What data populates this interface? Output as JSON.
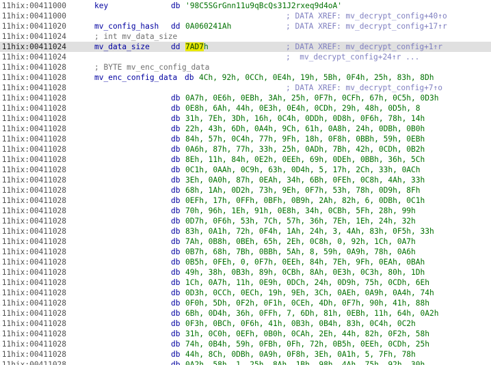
{
  "highlight_color": "#e8e800",
  "selected_line_color": "#e0e0e0",
  "lines": [
    {
      "addr": ".11hix:00411000",
      "label": "key",
      "dir": "db",
      "ops": "'98C5SGrGnn11u9qBcQs31J2rxeq9d4oA'"
    },
    {
      "addr": ".11hix:00411000",
      "xref": "; DATA XREF: mv_decrypt_config+40↑o"
    },
    {
      "addr": ".11hix:00411020",
      "label": "mv_config_hash",
      "dir": "dd",
      "ops": "0A060241Ah",
      "xref": "; DATA XREF: mv_decrypt_config+17↑r"
    },
    {
      "addr": ".11hix:00411024",
      "comment": "; int mv_data_size"
    },
    {
      "addr": ".11hix:00411024",
      "label": "mv_data_size",
      "dir": "dd",
      "ops_hl": "7AD7",
      "ops_tail": "h",
      "xref": "; DATA XREF: mv_decrypt_config+1↑r",
      "selected": true
    },
    {
      "addr": ".11hix:00411024",
      "xref": ";  mv_decrypt_config+24↑r ..."
    },
    {
      "addr": ".11hix:00411028",
      "comment": "; BYTE mv_enc_config_data"
    },
    {
      "addr": ".11hix:00411028",
      "label": "mv_enc_config_data",
      "dir": "db",
      "ops": "4Ch, 92h, 0CCh, 0E4h, 19h, 5Bh, 0F4h, 25h, 83h, 8Dh"
    },
    {
      "addr": ".11hix:00411028",
      "xref": "; DATA XREF: mv_decrypt_config+7↑o"
    },
    {
      "addr": ".11hix:00411028",
      "dir": "db",
      "ops": "0A7h, 0E6h, 0EBh, 3Ah, 25h, 0F7h, 0CFh, 67h, 0C5h, 0D3h"
    },
    {
      "addr": ".11hix:00411028",
      "dir": "db",
      "ops": "0E8h, 6Ah, 44h, 0E3h, 0E4h, 0CDh, 29h, 48h, 0D5h, 8"
    },
    {
      "addr": ".11hix:00411028",
      "dir": "db",
      "ops": "31h, 7Eh, 3Dh, 16h, 0C4h, 0DDh, 0D8h, 0F6h, 78h, 14h"
    },
    {
      "addr": ".11hix:00411028",
      "dir": "db",
      "ops": "22h, 43h, 6Dh, 0A4h, 9Ch, 61h, 0A8h, 24h, 0DBh, 0B0h"
    },
    {
      "addr": ".11hix:00411028",
      "dir": "db",
      "ops": "84h, 57h, 0C4h, 77h, 9Fh, 18h, 0F8h, 0BBh, 59h, 0EBh"
    },
    {
      "addr": ".11hix:00411028",
      "dir": "db",
      "ops": "0A6h, 87h, 77h, 33h, 25h, 0ADh, 7Bh, 42h, 0CDh, 0B2h"
    },
    {
      "addr": ".11hix:00411028",
      "dir": "db",
      "ops": "8Eh, 11h, 84h, 0E2h, 0EEh, 69h, 0DEh, 0BBh, 36h, 5Ch"
    },
    {
      "addr": ".11hix:00411028",
      "dir": "db",
      "ops": "0C1h, 0AAh, 0C9h, 63h, 0D4h, 5, 17h, 2Ch, 33h, 0ACh"
    },
    {
      "addr": ".11hix:00411028",
      "dir": "db",
      "ops": "3Eh, 0A0h, 87h, 0EAh, 34h, 6Bh, 0FEh, 0C8h, 4Ah, 33h"
    },
    {
      "addr": ".11hix:00411028",
      "dir": "db",
      "ops": "68h, 1Ah, 0D2h, 73h, 9Eh, 0F7h, 53h, 78h, 0D9h, 8Fh"
    },
    {
      "addr": ".11hix:00411028",
      "dir": "db",
      "ops": "0EFh, 17h, 0FFh, 0BFh, 0B9h, 2Ah, 82h, 6, 0DBh, 0C1h"
    },
    {
      "addr": ".11hix:00411028",
      "dir": "db",
      "ops": "70h, 96h, 1Eh, 91h, 0E8h, 34h, 0CBh, 5Fh, 28h, 99h"
    },
    {
      "addr": ".11hix:00411028",
      "dir": "db",
      "ops": "0D7h, 0F6h, 53h, 7Ch, 57h, 36h, 7Eh, 1Eh, 24h, 32h"
    },
    {
      "addr": ".11hix:00411028",
      "dir": "db",
      "ops": "83h, 0A1h, 72h, 0F4h, 1Ah, 24h, 3, 4Ah, 83h, 0F5h, 33h"
    },
    {
      "addr": ".11hix:00411028",
      "dir": "db",
      "ops": "7Ah, 0B8h, 0BEh, 65h, 2Eh, 0C8h, 0, 92h, 1Ch, 0A7h"
    },
    {
      "addr": ".11hix:00411028",
      "dir": "db",
      "ops": "0B7h, 68h, 7Bh, 0BBh, 5Ah, 8, 59h, 0A9h, 78h, 0A6h"
    },
    {
      "addr": ".11hix:00411028",
      "dir": "db",
      "ops": "0B5h, 0FEh, 0, 0F7h, 0EEh, 84h, 7Eh, 9Fh, 0EAh, 0BAh"
    },
    {
      "addr": ".11hix:00411028",
      "dir": "db",
      "ops": "49h, 38h, 0B3h, 89h, 0CBh, 8Ah, 0E3h, 0C3h, 80h, 1Dh"
    },
    {
      "addr": ".11hix:00411028",
      "dir": "db",
      "ops": "1Ch, 0A7h, 11h, 0E9h, 0DCh, 24h, 0D9h, 75h, 0CDh, 6Eh"
    },
    {
      "addr": ".11hix:00411028",
      "dir": "db",
      "ops": "0D3h, 0CCh, 0ECh, 19h, 9Eh, 3Ch, 0AEh, 0A9h, 0A4h, 74h"
    },
    {
      "addr": ".11hix:00411028",
      "dir": "db",
      "ops": "0F0h, 5Dh, 0F2h, 0F1h, 0CEh, 4Dh, 0F7h, 90h, 41h, 88h"
    },
    {
      "addr": ".11hix:00411028",
      "dir": "db",
      "ops": "6Bh, 0D4h, 36h, 0FFh, 7, 6Dh, 81h, 0EBh, 11h, 64h, 0A2h"
    },
    {
      "addr": ".11hix:00411028",
      "dir": "db",
      "ops": "0F3h, 0BCh, 0F6h, 41h, 0B3h, 0B4h, 83h, 0C4h, 0C2h"
    },
    {
      "addr": ".11hix:00411028",
      "dir": "db",
      "ops": "31h, 0C0h, 0EFh, 0B0h, 0CAh, 2Eh, 44h, 82h, 0F2h, 58h"
    },
    {
      "addr": ".11hix:00411028",
      "dir": "db",
      "ops": "74h, 0B4h, 59h, 0FBh, 0Fh, 72h, 0B5h, 0EEh, 0CDh, 25h"
    },
    {
      "addr": ".11hix:00411028",
      "dir": "db",
      "ops": "44h, 8Ch, 0DBh, 0A9h, 0F8h, 3Eh, 0A1h, 5, 7Fh, 78h"
    },
    {
      "addr": ".11hix:00411028",
      "dir": "db",
      "ops": "0A2h, 58h, 1, 25h, 8Ah, 1Bh, 98h, 4Ah, 75h, 92h, 30h"
    }
  ]
}
